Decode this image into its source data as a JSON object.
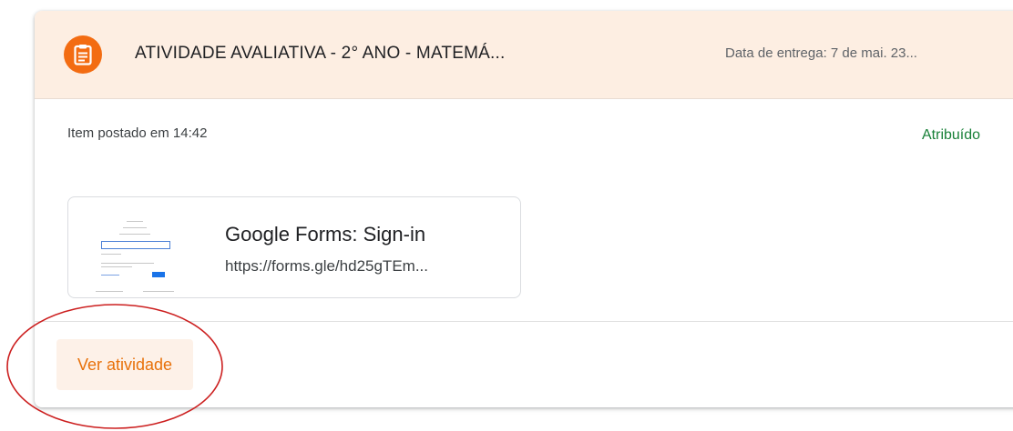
{
  "assignment": {
    "title": "ATIVIDADE AVALIATIVA - 2° ANO - MATEMÁ...",
    "due_date": "Data de entrega: 7 de mai. 23...",
    "icon": "assignment-icon",
    "posted": "Item postado em 14:42",
    "status": "Atribuído"
  },
  "attachment": {
    "title": "Google Forms: Sign-in",
    "url": "https://forms.gle/hd25gTEm...",
    "thumbnail_icon": "google-sign-in-thumbnail"
  },
  "actions": {
    "view_label": "Ver atividade"
  },
  "colors": {
    "accent": "#f36c12",
    "header_bg": "#fdeee2",
    "status": "#188038",
    "button_text": "#e8710a",
    "annotation": "#cc1f1f"
  }
}
